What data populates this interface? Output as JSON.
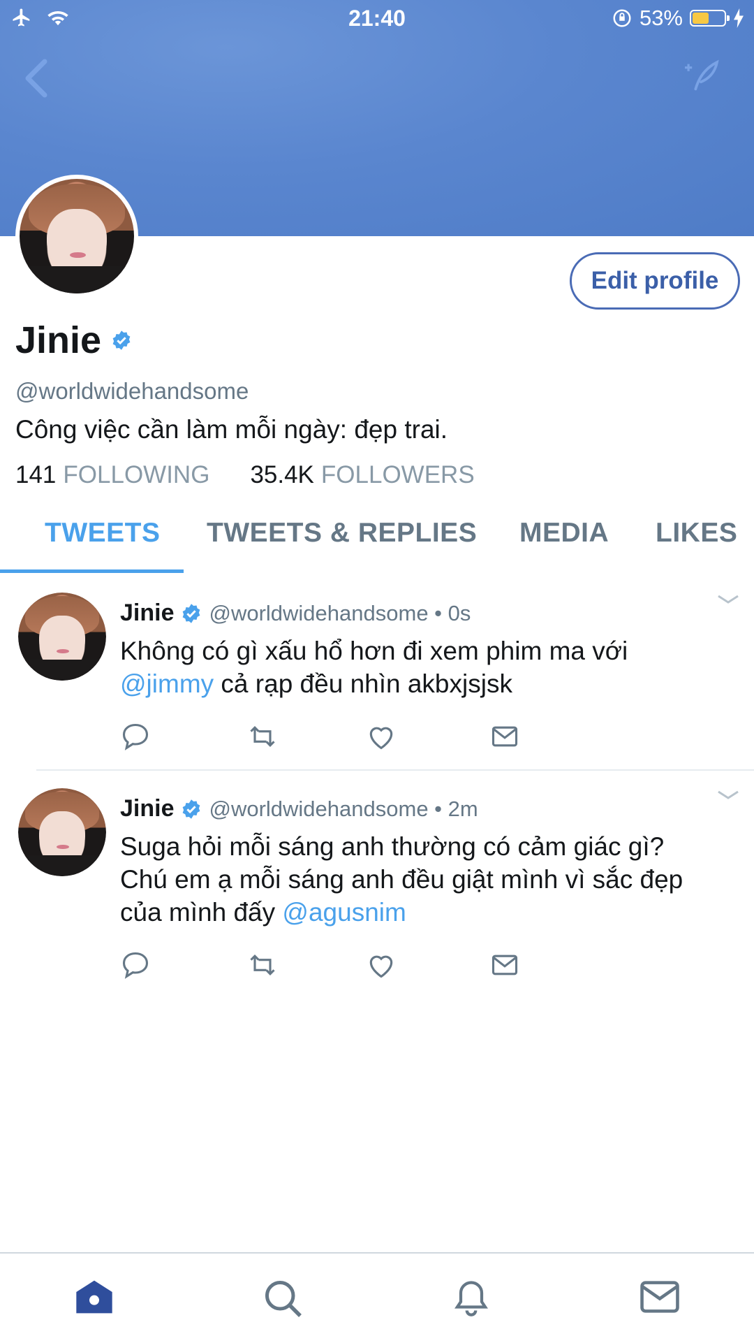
{
  "status_bar": {
    "time": "21:40",
    "battery_percent": "53%",
    "battery_level": 0.53
  },
  "profile": {
    "edit_button": "Edit profile",
    "name": "Jinie",
    "handle": "@worldwidehandsome",
    "bio": "Công việc cần làm mỗi ngày: đẹp trai.",
    "following_count": "141",
    "following_label": "FOLLOWING",
    "followers_count": "35.4K",
    "followers_label": "FOLLOWERS"
  },
  "tabs": [
    "TWEETS",
    "TWEETS & REPLIES",
    "MEDIA",
    "LIKES"
  ],
  "tweets": [
    {
      "name": "Jinie",
      "meta": "@worldwidehandsome • 0s",
      "line1": "Không có gì xấu hổ hơn đi xem phim ma với",
      "mention1": "@jimmy",
      "rest1": " cả rạp đều nhìn akbxjsjsk"
    },
    {
      "name": "Jinie",
      "meta": "@worldwidehandsome • 2m",
      "line1": "Suga hỏi mỗi sáng anh thường có cảm giác gì?",
      "line2": "Chú em ạ mỗi sáng anh đều giật mình vì sắc đẹp",
      "line3": "của mình đấy ",
      "mention": "@agusnim"
    }
  ],
  "colors": {
    "accent": "#4aa1eb",
    "header_blue": "#5a86cf",
    "secondary_text": "#657786",
    "nav_blue": "#2f4e9c"
  },
  "icons": [
    "airplane-icon",
    "wifi-icon",
    "rotation-lock-icon",
    "battery-icon",
    "charging-icon",
    "back-arrow-icon",
    "compose-icon",
    "verified-badge-icon",
    "reply-icon",
    "retweet-icon",
    "like-icon",
    "message-icon",
    "chevron-down-icon",
    "home-icon",
    "search-icon",
    "notifications-icon",
    "messages-icon"
  ]
}
